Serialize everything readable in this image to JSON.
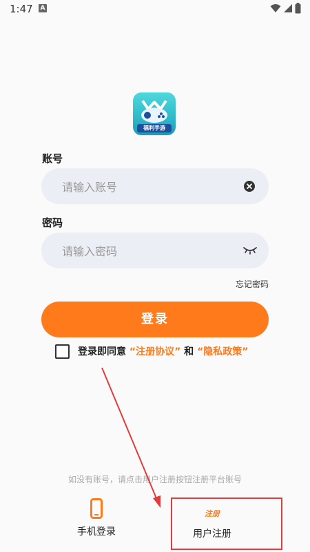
{
  "status_bar": {
    "time": "1:47",
    "notification_letter": "A"
  },
  "app": {
    "logo_text": "福利手游"
  },
  "account": {
    "label": "账号",
    "placeholder": "请输入账号",
    "value": ""
  },
  "password": {
    "label": "密码",
    "placeholder": "请输入密码",
    "value": ""
  },
  "forgot_password": "忘记密码",
  "login_button": "登录",
  "agreement": {
    "prefix": "登录即同意 ",
    "terms_link": "“注册协议”",
    "connector": " 和 ",
    "privacy_link": "“隐私政策”",
    "checked": false
  },
  "hint": "如没有账号，请点击用户注册按钮注册平台账号",
  "bottom_tabs": {
    "phone_login": "手机登录",
    "register_badge": "注册",
    "user_register": "用户注册"
  },
  "colors": {
    "accent": "#ff7a1a",
    "highlight_box": "#e23b3b"
  }
}
